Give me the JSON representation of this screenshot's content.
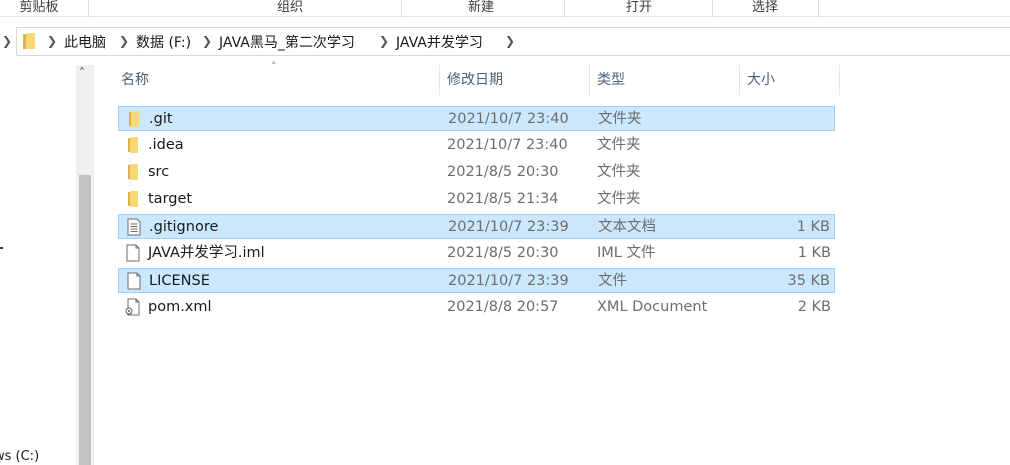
{
  "ribbon": {
    "groups": [
      "剪贴板",
      "组织",
      "新建",
      "打开",
      "选择"
    ]
  },
  "address": {
    "crumbs": [
      "此电脑",
      "数据 (F:)",
      "JAVA黑马_第二次学习",
      "JAVA并发学习"
    ]
  },
  "nav": {
    "partial_item": "ws (C:)"
  },
  "columns": {
    "name": "名称",
    "date": "修改日期",
    "type": "类型",
    "size": "大小"
  },
  "files": [
    {
      "name": ".git",
      "date": "2021/10/7 23:40",
      "type": "文件夹",
      "size": "",
      "icon": "folder-icon",
      "selected": true
    },
    {
      "name": ".idea",
      "date": "2021/10/7 23:40",
      "type": "文件夹",
      "size": "",
      "icon": "folder-icon",
      "selected": false
    },
    {
      "name": "src",
      "date": "2021/8/5 20:30",
      "type": "文件夹",
      "size": "",
      "icon": "folder-icon",
      "selected": false
    },
    {
      "name": "target",
      "date": "2021/8/5 21:34",
      "type": "文件夹",
      "size": "",
      "icon": "folder-icon",
      "selected": false
    },
    {
      "name": ".gitignore",
      "date": "2021/10/7 23:39",
      "type": "文本文档",
      "size": "1 KB",
      "icon": "text-document-icon",
      "selected": true
    },
    {
      "name": "JAVA并发学习.iml",
      "date": "2021/8/5 20:30",
      "type": "IML 文件",
      "size": "1 KB",
      "icon": "blank-file-icon",
      "selected": false
    },
    {
      "name": "LICENSE",
      "date": "2021/10/7 23:39",
      "type": "文件",
      "size": "35 KB",
      "icon": "blank-file-icon",
      "selected": true
    },
    {
      "name": "pom.xml",
      "date": "2021/8/8 20:57",
      "type": "XML Document",
      "size": "2 KB",
      "icon": "xml-file-icon",
      "selected": false
    }
  ],
  "colors": {
    "selection_bg": "#cce8ff",
    "selection_border": "#99d1ff",
    "folder": "#f8d775",
    "header_text": "#4c607a"
  }
}
